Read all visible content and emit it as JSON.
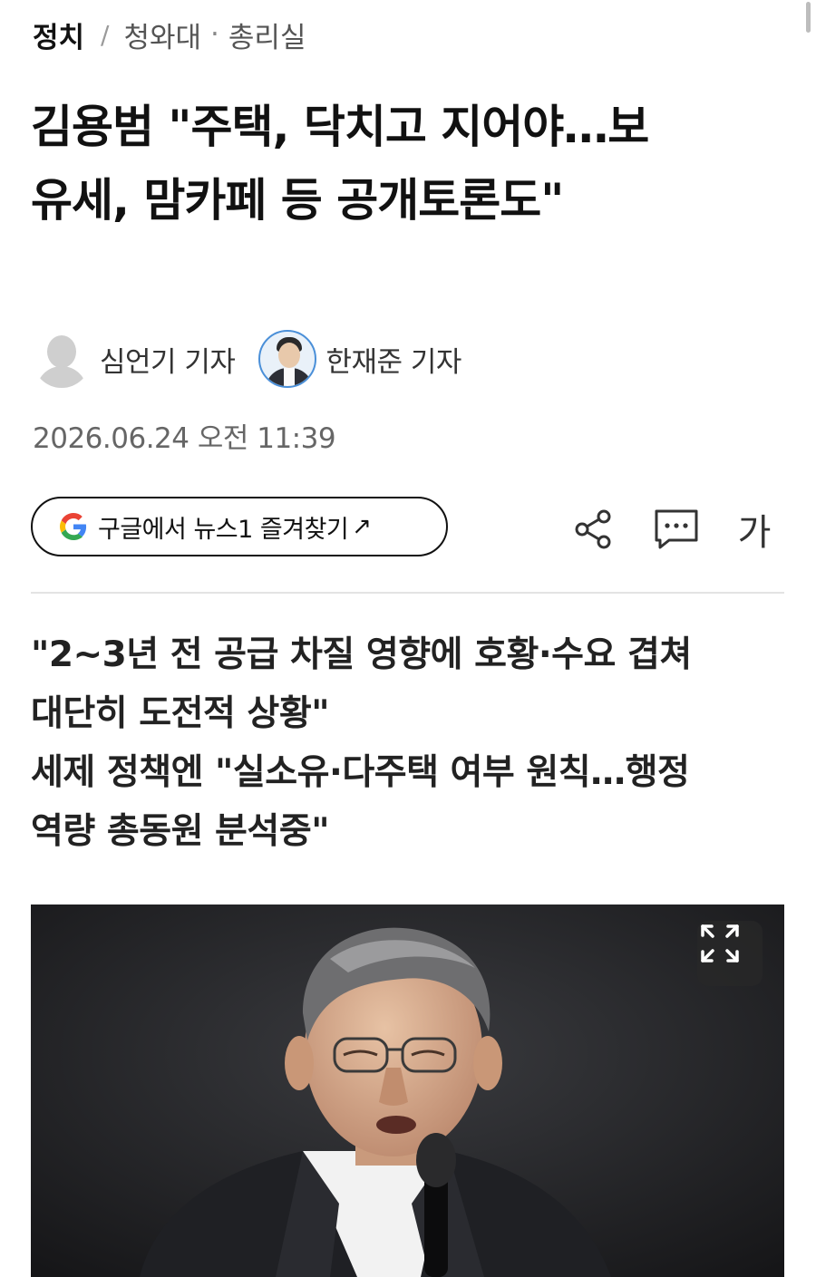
{
  "breadcrumb": {
    "section": "정치",
    "separator": "/",
    "sub1": "청와대",
    "dot": "·",
    "sub2": "총리실"
  },
  "headline": {
    "line1": "김용범 \"주택, 닥치고 지어야…보",
    "line2": "유세, 맘카페 등 공개토론도\""
  },
  "reporters": [
    {
      "name": "심언기 기자",
      "avatar": "default-avatar-icon"
    },
    {
      "name": "한재준 기자",
      "avatar": "reporter-photo"
    }
  ],
  "date": "2026.06.24 오전 11:39",
  "google_button": {
    "label": "구글에서 뉴스1 즐겨찾기",
    "arrow": "↗"
  },
  "toolbar": {
    "share_icon": "share-icon",
    "comment_icon": "comment-icon",
    "font_label": "가"
  },
  "subheadline": {
    "line1": "\"2~3년 전 공급 차질 영향에 호황·수요 겹쳐",
    "line2": "대단히 도전적 상황\"",
    "line3": "세제 정책엔 \"실소유·다주택 여부 원칙…행정",
    "line4": "역량 총동원 분석중\""
  },
  "photo": {
    "expand_icon": "expand-icon"
  },
  "colors": {
    "text": "#111111",
    "muted": "#666666",
    "divider": "#e3e3e3",
    "google_blue": "#4285F4",
    "google_red": "#EA4335",
    "google_yellow": "#FBBC05",
    "google_green": "#34A853"
  }
}
